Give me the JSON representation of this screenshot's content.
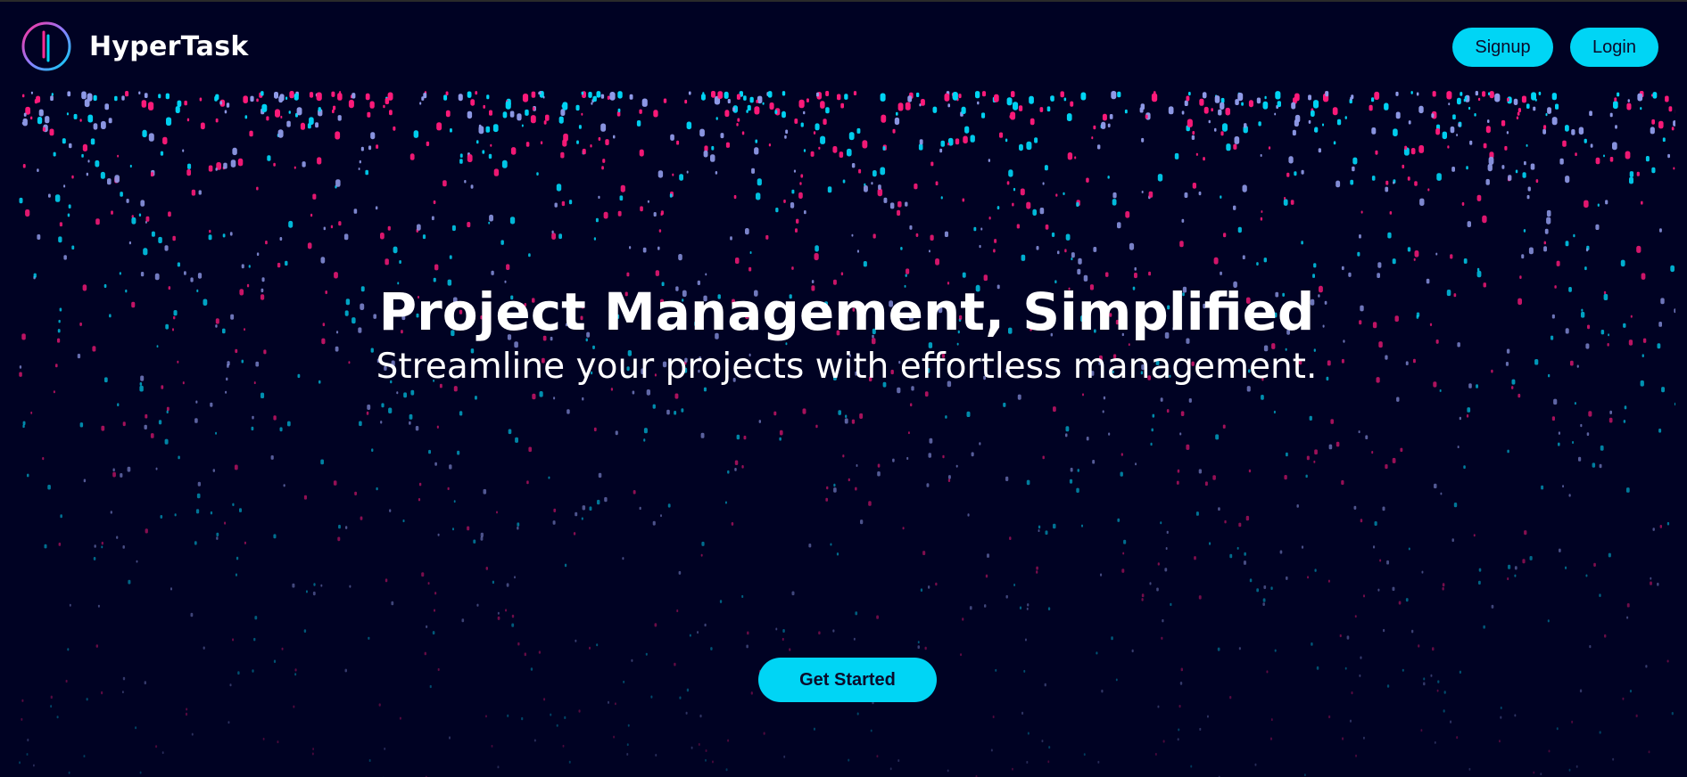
{
  "header": {
    "brand": "HyperTask",
    "signup_label": "Signup",
    "login_label": "Login"
  },
  "hero": {
    "title": "Project Management, Simplified",
    "subtitle": "Streamline your projects with effortless management.",
    "cta_label": "Get Started"
  },
  "theme": {
    "background": "#000223",
    "accent": "#00d5f5",
    "particle_colors": [
      "#ff1a7a",
      "#00d5f5",
      "#8f9ae8",
      "#ffffff"
    ]
  },
  "icons": {
    "logo": "hypertask-logo-icon"
  }
}
